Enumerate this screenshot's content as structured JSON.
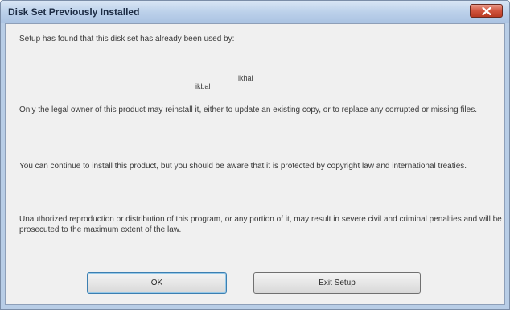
{
  "window": {
    "title": "Disk Set Previously Installed",
    "close_icon": "close-icon"
  },
  "message": {
    "intro": "Setup has found that this disk set has already been used by:",
    "owner_org": "ikhal",
    "owner_name": "ikbal",
    "legal_owner": "Only the legal owner of this product may reinstall it, either to update an existing copy, or to replace any corrupted or missing files.",
    "continue": "You can continue to install this product, but you should be aware that it is protected by copyright law and international treaties.",
    "warning": "Unauthorized reproduction or distribution of this program, or any portion of it, may result in severe civil and criminal penalties and will be prosecuted to the maximum extent of the law."
  },
  "buttons": {
    "ok_label": "OK",
    "exit_label": "Exit Setup"
  },
  "colors": {
    "title_bar": "#bcd1ea",
    "close_button": "#d1543d",
    "client_background": "#f0f0f0",
    "default_button_border": "#3c7fb1"
  }
}
